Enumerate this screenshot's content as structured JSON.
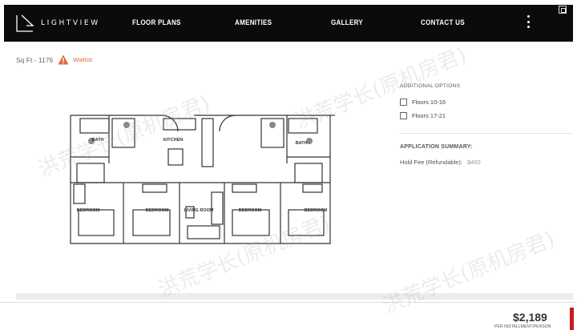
{
  "header": {
    "logo_text": "LIGHTVIEW",
    "nav": [
      "FLOOR PLANS",
      "AMENITIES",
      "GALLERY",
      "CONTACT US"
    ],
    "menu_icon": "kebab-menu-icon"
  },
  "unit": {
    "sqft_label": "Sq Ft - 1176",
    "status_label": "Waitlist",
    "status_icon": "warning-icon"
  },
  "floorplan": {
    "labels": [
      "BATH",
      "KITCHEN",
      "BATH",
      "BEDROOM",
      "BEDROOM",
      "LIVING ROOM",
      "BEDROOM",
      "BEDROOM"
    ]
  },
  "options": {
    "title": "ADDITIONAL OPTIONS",
    "items": [
      "Floors 10-16",
      "Floors 17-21"
    ]
  },
  "summary": {
    "title": "APPLICATION SUMMARY:",
    "hold_fee_label": "Hold Fee (Refundable):",
    "hold_fee_value": "$400"
  },
  "price": {
    "amount": "$2,189",
    "unit_label": "PER INSTALLMENT/PERSON"
  },
  "watermark_text": "洪荒学长(原机房君)",
  "colors": {
    "header_bg": "#0b0b0b",
    "accent": "#e06a3a",
    "cta": "#cc1a1a"
  }
}
